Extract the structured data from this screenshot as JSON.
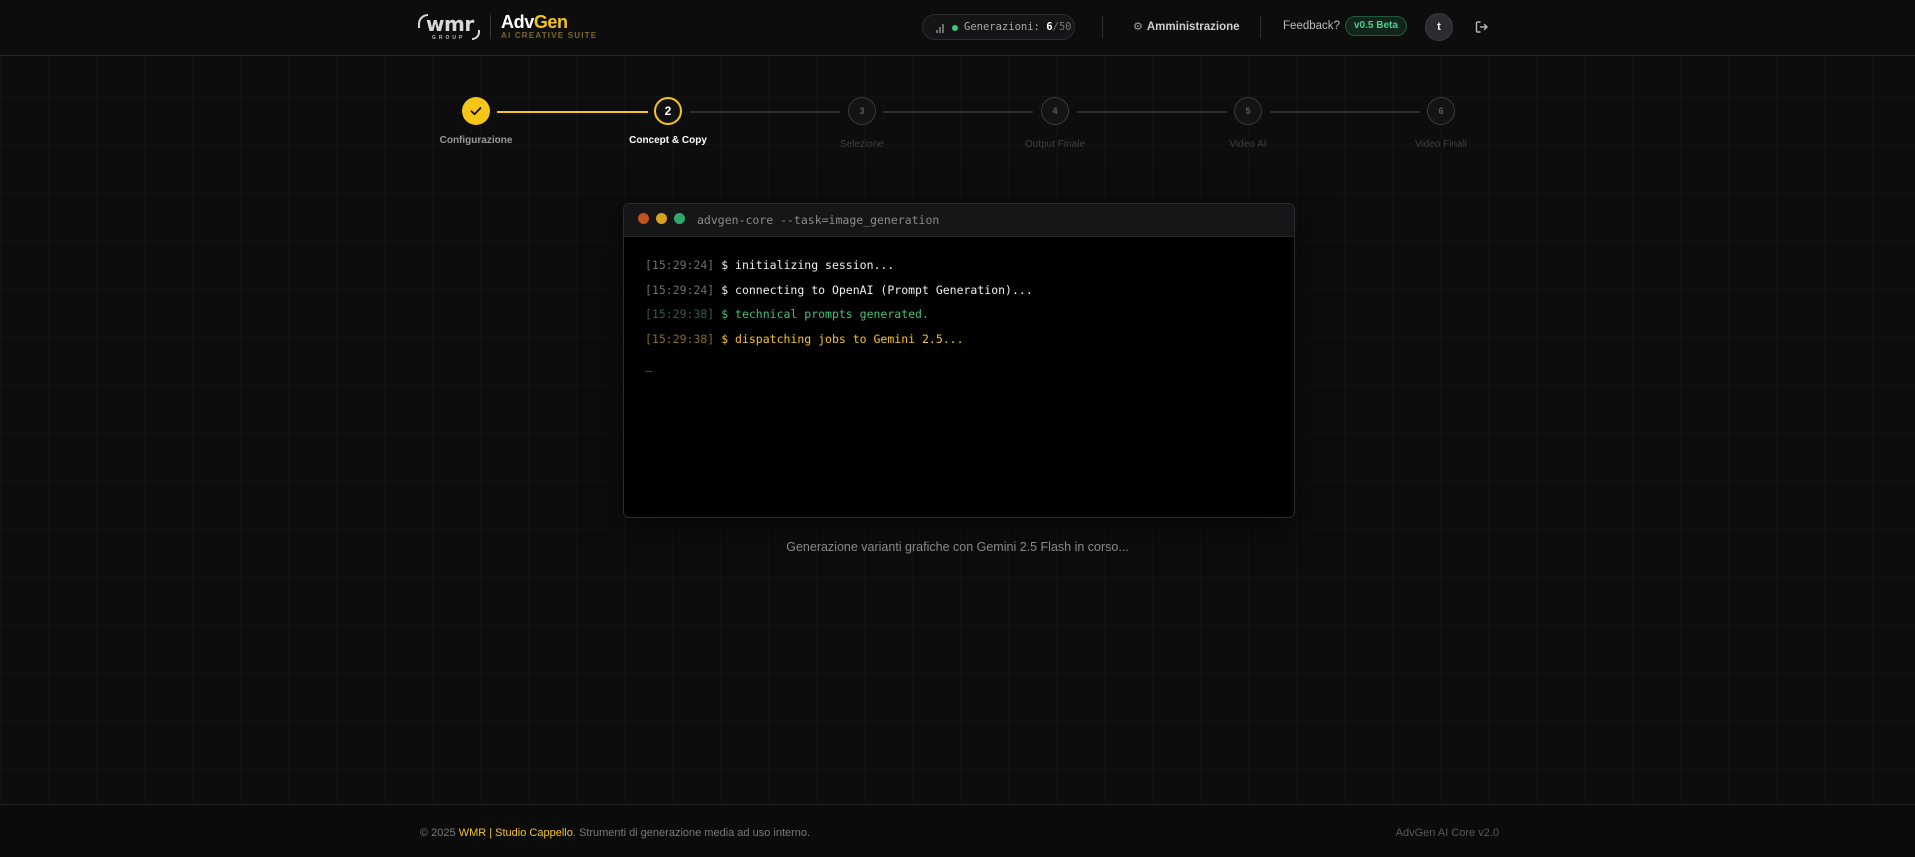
{
  "header": {
    "logo_wmr": "wmr",
    "logo_group": "GROUP",
    "brand_adv": "Adv",
    "brand_gen": "Gen",
    "brand_sub": "AI CREATIVE SUITE",
    "generations_label": "Generazioni:",
    "generations_used": "6",
    "generations_total": "/50",
    "admin_label": "Amministrazione",
    "feedback_label": "Feedback?",
    "version_badge": "v0.5 Beta",
    "avatar_initial": "t",
    "accent_color": "#f5c518",
    "success_color": "#3ec27a"
  },
  "stepper": {
    "steps": [
      {
        "number": "1",
        "label": "Configurazione",
        "state": "done"
      },
      {
        "number": "2",
        "label": "Concept & Copy",
        "state": "active"
      },
      {
        "number": "3",
        "label": "Selezione",
        "state": "pending"
      },
      {
        "number": "4",
        "label": "Output Finale",
        "state": "pending"
      },
      {
        "number": "5",
        "label": "Video AI",
        "state": "pending"
      },
      {
        "number": "6",
        "label": "Video Finali",
        "state": "pending"
      }
    ]
  },
  "terminal": {
    "title": "advgen-core --task=image_generation",
    "lines": [
      {
        "time": "[15:29:24]",
        "text": "$ initializing session...",
        "color": "white"
      },
      {
        "time": "[15:29:24]",
        "text": "$ connecting to OpenAI (Prompt Generation)...",
        "color": "white"
      },
      {
        "time": "[15:29:38]",
        "text": "$ technical prompts generated.",
        "color": "green"
      },
      {
        "time": "[15:29:38]",
        "text": "$ dispatching jobs to Gemini 2.5...",
        "color": "yellow"
      }
    ],
    "cursor": "_"
  },
  "status": {
    "text": "Generazione varianti grafiche con Gemini 2.5 Flash in corso..."
  },
  "footer": {
    "copyright": "© 2025 ",
    "brand": "WMR | Studio Cappello",
    "rest": ". Strumenti di generazione media ad uso interno.",
    "version": "AdvGen AI Core v2.0"
  }
}
